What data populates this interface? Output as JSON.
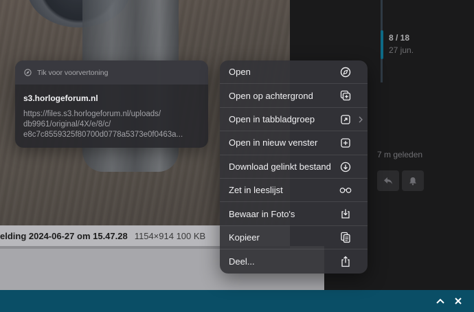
{
  "background": {
    "caption_title": "elding 2024-06-27 om 15.47.28",
    "caption_meta": "1154×914 100 KB"
  },
  "timeline": {
    "count": "8 / 18",
    "date": "27 jun.",
    "progress_fraction": 0.44
  },
  "post": {
    "ago": "7 m geleden",
    "reply_icon": "reply-icon",
    "bell_icon": "bell-icon"
  },
  "preview": {
    "header_icon": "compass-icon",
    "header_text": "Tik voor voorvertoning",
    "title": "s3.horlogeforum.nl",
    "url_lines": [
      "https://files.s3.horlogeforum.nl/uploads/",
      "db9961/original/4X/e/8/c/",
      "e8c7c8559325f80700d0778a5373e0f0463a..."
    ]
  },
  "menu": {
    "items": [
      {
        "label": "Open",
        "icon": "compass-icon"
      },
      {
        "label": "Open op achtergrond",
        "icon": "add-tab-icon"
      },
      {
        "label": "Open in tabbladgroep",
        "icon": "tab-group-icon"
      },
      {
        "label": "Open in nieuw venster",
        "icon": "new-window-icon"
      },
      {
        "label": "Download gelinkt bestand",
        "icon": "download-icon"
      },
      {
        "label": "Zet in leeslijst",
        "icon": "glasses-icon"
      },
      {
        "label": "Bewaar in Foto's",
        "icon": "save-photo-icon"
      },
      {
        "label": "Kopieer",
        "icon": "copy-icon"
      },
      {
        "label": "Deel...",
        "icon": "share-icon"
      }
    ]
  },
  "bottom_bar": {
    "up_icon": "chevron-up-icon",
    "close_icon": "close-icon",
    "color": "#0a4e66"
  },
  "colors": {
    "accent": "#0e6a86",
    "menu_bg": "#343438"
  }
}
